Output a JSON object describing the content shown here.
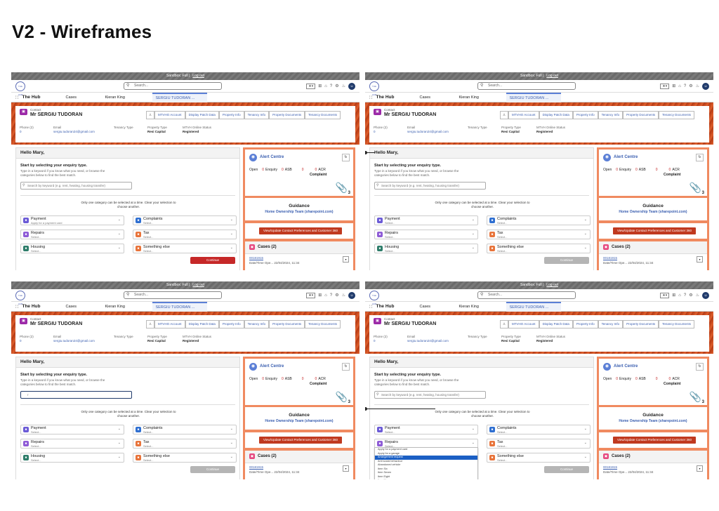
{
  "title": "V2 - Wireframes",
  "shell": {
    "sandbox_label": "Sandbox: Full |",
    "logout_label": "Log out",
    "logo_text": "THE HUB",
    "search_placeholder": "Search...",
    "app_name": "The Hub",
    "tab_cases": "Cases",
    "tab_user": "Kieran King",
    "tab_record": "SERGIU TUDORAN ..."
  },
  "contact": {
    "label": "Contact",
    "name": "Mr SERGIU TUDORAN",
    "actions": [
      "MTVHO Account",
      "Display Patch Data",
      "Property Info",
      "Tenancy Info",
      "Property Documents",
      "Tenancy Documents"
    ],
    "phone_label": "Phone (2)",
    "phone_value": "0",
    "email_label": "Email",
    "email_value": "sergiu.tudoran24@gmail.com",
    "tenancy_type_label": "Tenancy Type",
    "property_type_label": "Property Type",
    "property_type_value": "Resi Capital",
    "online_status_label": "MTVH Online Status",
    "online_status_value": "Registered"
  },
  "enquiry": {
    "greeting": "Hello Mary,",
    "heading": "Start by selecting your enquiry type.",
    "subtext": "Type in a keyword if you know what you need, or browse the categories below to find the best match.",
    "search_placeholder": "Search by keyword (e.g. rent, heating, housing transfer)",
    "typed_value": "r",
    "instruction": "Only one category can be selected at a time. Clear your selection to choose another.",
    "continue_label": "Continue",
    "categories": [
      {
        "name": "Payment",
        "sub": "Select...",
        "sub_first": "Apply for a payment card",
        "color": "#6b5bd6",
        "icon": "card-icon"
      },
      {
        "name": "Complaints",
        "sub": "Select...",
        "color": "#2f6fd1",
        "icon": "complaint-icon"
      },
      {
        "name": "Repairs",
        "sub": "Select...",
        "color": "#8e5bd6",
        "icon": "wrench-icon"
      },
      {
        "name": "Tax",
        "sub": "Select...",
        "color": "#e8743b",
        "icon": "tax-icon"
      },
      {
        "name": "Housing",
        "sub": "Select...",
        "color": "#2e7d6a",
        "icon": "house-icon"
      },
      {
        "name": "Something else",
        "sub": "Select...",
        "color": "#e8743b",
        "icon": "more-icon"
      }
    ],
    "dropdown_options": [
      "Apply for a payment card",
      "Apply for a garage",
      "Arrangement request",
      "Anti social behaviour",
      "Abandoned vehicle",
      "Item Six",
      "Item Seven",
      "Item Eight",
      "Item Nine",
      "Item Ten"
    ]
  },
  "alerts": {
    "title": "Alert Centre",
    "open_label": "Open",
    "enquiry_count": "0",
    "enquiry_label": "Enquiry",
    "asb_count": "0",
    "asb_label": "ASB",
    "complaint_count": "0",
    "complaint_label": "Complaint",
    "acr_count": "0",
    "acr_label": "ACR",
    "attachments": "3"
  },
  "guidance": {
    "title": "Guidance",
    "link": "Home Ownership Team (sharepoint.com)",
    "view_button": "View/Update Contact Preferences and Customer 360"
  },
  "cases": {
    "title": "Cases (2)",
    "case_number": "00181915",
    "date_label": "Date/Time Ope...",
    "date_value": "22/04/2024, 11:34"
  },
  "colors": {
    "continue_active": "#c62828",
    "continue_disabled": "#b5b5b5",
    "banner": "#c84a1e",
    "side_panel": "#f08a60",
    "dropdown_selected": "#1b5fc4"
  }
}
